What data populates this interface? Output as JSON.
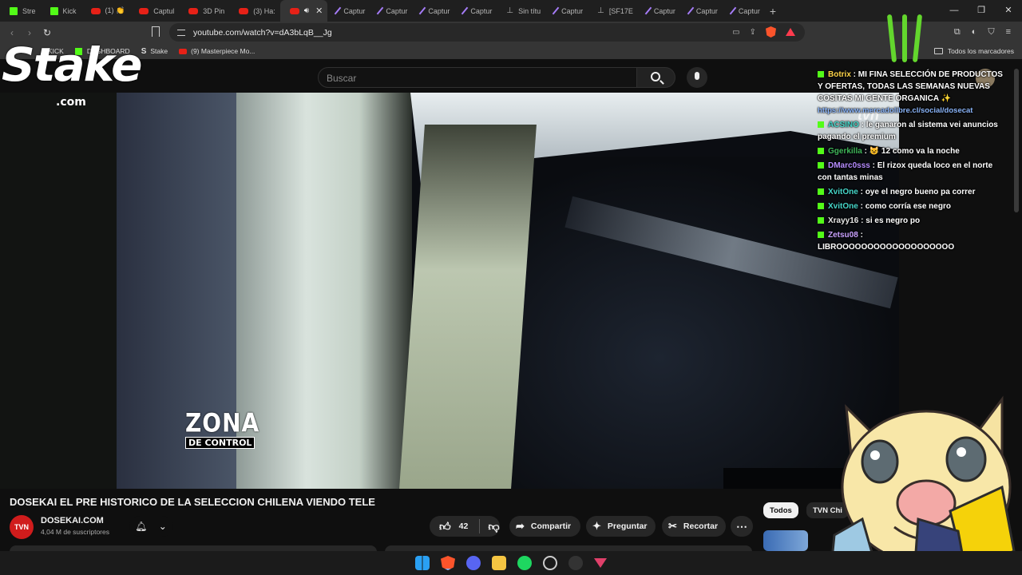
{
  "browser": {
    "tabs": [
      {
        "label": "Stre",
        "icon": "kick-icon"
      },
      {
        "label": "Kick",
        "icon": "kick-icon"
      },
      {
        "label": "(1) 👏",
        "icon": "youtube-icon"
      },
      {
        "label": "Captul",
        "icon": "youtube-icon"
      },
      {
        "label": "3D Pin",
        "icon": "youtube-icon"
      },
      {
        "label": "(3) Ha:",
        "icon": "youtube-icon"
      },
      {
        "label": "",
        "icon": "youtube-icon"
      },
      {
        "label": "Captur",
        "icon": "pen-icon"
      },
      {
        "label": "Captur",
        "icon": "pen-icon"
      },
      {
        "label": "Captur",
        "icon": "pen-icon"
      },
      {
        "label": "Captur",
        "icon": "pen-icon"
      },
      {
        "label": "Sin títu",
        "icon": "upload-icon"
      },
      {
        "label": "Captur",
        "icon": "pen-icon"
      },
      {
        "label": "[SF17E",
        "icon": "upload-icon"
      },
      {
        "label": "Captur",
        "icon": "pen-icon"
      },
      {
        "label": "Captur",
        "icon": "pen-icon"
      },
      {
        "label": "Captur",
        "icon": "pen-icon"
      }
    ],
    "url": "youtube.com/watch?v=dA3bLqB__Jg",
    "bookmarks": [
      {
        "label": "KICK"
      },
      {
        "label": "DASHBOARD"
      },
      {
        "label": "Stake"
      },
      {
        "label": "(9) Masterpiece Mo..."
      }
    ],
    "bookmarks_folder": "Todos los marcadores"
  },
  "youtube": {
    "search_placeholder": "Buscar",
    "video": {
      "overlay_zona": "ZONA",
      "overlay_control": "DE CONTROL"
    },
    "title": "DOSEKAI EL PRE HISTORICO DE LA SELECCION CHILENA VIENDO TELE",
    "channel": {
      "avatar_text": "TVN",
      "name": "DOSEKAI.COM",
      "subscribers": "4,04 M de suscriptores"
    },
    "actions": {
      "likes": "42",
      "share": "Compartir",
      "ask": "Preguntar",
      "clip": "Recortar"
    },
    "chips": [
      "Todos",
      "TVN Chi"
    ]
  },
  "stream_overlay": {
    "stake_logo": "Stake",
    "stake_domain": ".com",
    "tvn_logo": "tvn",
    "chat": [
      {
        "user": "Botrix",
        "text": "MI FINA SELECCIÓN DE PRODUCTOS Y OFERTAS, TODAS LAS SEMANAS NUEVAS COSITAS MI GENTE ORGANICA ✨",
        "link": "https://www.mercadolibre.cl/social/dosecat"
      },
      {
        "user": "ACSINO",
        "text": "le ganaron al sistema vei anuncios pagando el premium"
      },
      {
        "user": "Ggerkilla",
        "text": "😺 12 como va la noche"
      },
      {
        "user": "DMarc0sss",
        "text": "El rizox queda loco en el norte con tantas minas"
      },
      {
        "user": "XvitOne",
        "text": "oye el negro bueno pa correr"
      },
      {
        "user": "XvitOne",
        "text": "como corría ese negro"
      },
      {
        "user": "Xrayy16",
        "text": "si es negro po"
      },
      {
        "user": "Zetsu08",
        "text": "LIBROOOOOOOOOOOOOOOOOOO"
      }
    ]
  },
  "colors": {
    "youtube_bg": "#0f0f0f",
    "kick_green": "#53fc18",
    "youtube_red": "#e62117",
    "link_blue": "#8ab4f8"
  }
}
